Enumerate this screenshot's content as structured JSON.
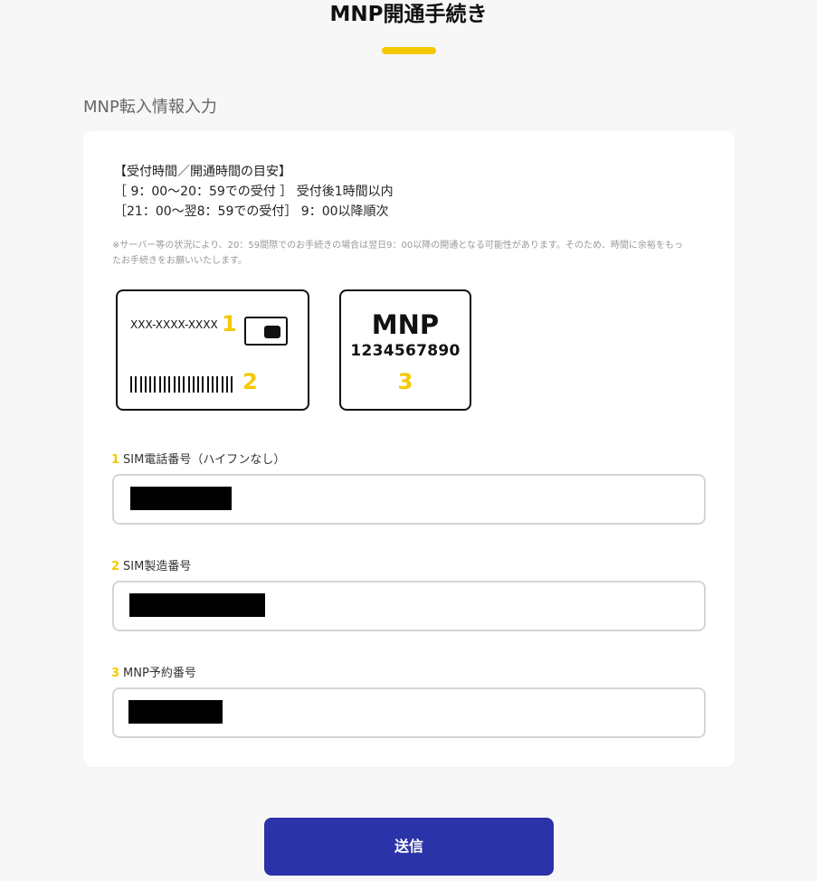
{
  "header": {
    "title": "MNP開通手続き"
  },
  "section": {
    "title": "MNP転入情報入力"
  },
  "info": {
    "hours_lines": [
      "【受付時間／開通時間の目安】",
      "［ 9：00〜20：59での受付 ］ 受付後1時間以内",
      "［21：00〜翌8：59での受付］ 9：00以降順次"
    ],
    "notice": "※サーバー等の状況により、20：59間際でのお手続きの場合は翌日9：00以降の開通となる可能性があります。そのため、時間に余裕をもったお手続きをお願いいたします。"
  },
  "illustration": {
    "sim_number_sample": "XXX-XXXX-XXXX",
    "marker1": "1",
    "marker2": "2",
    "mnp_label": "MNP",
    "mnp_number_sample": "1234567890",
    "marker3": "3"
  },
  "form": {
    "fields": [
      {
        "num": "1",
        "label": "SIM電話番号（ハイフンなし）"
      },
      {
        "num": "2",
        "label": "SIM製造番号"
      },
      {
        "num": "3",
        "label": "MNP予約番号"
      }
    ]
  },
  "submit": {
    "label": "送信",
    "color": "#2b33a8"
  },
  "colors": {
    "accent": "#f5c800",
    "background": "#f7f7f7"
  }
}
